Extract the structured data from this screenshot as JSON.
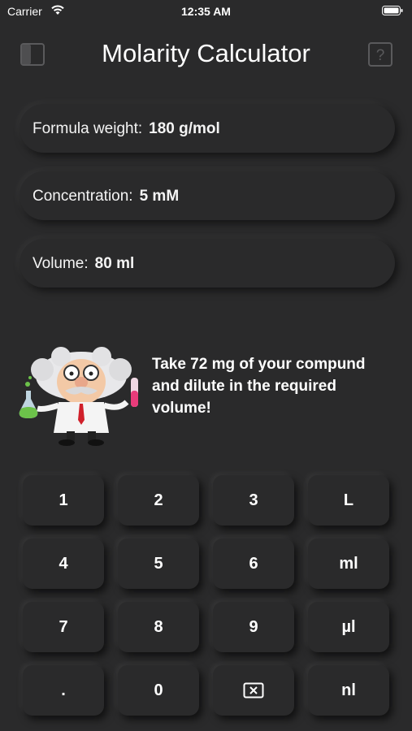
{
  "status": {
    "carrier": "Carrier",
    "time": "12:35 AM"
  },
  "nav": {
    "title": "Molarity Calculator"
  },
  "fields": {
    "formula_weight": {
      "label": "Formula weight:",
      "value": "180 g/mol"
    },
    "concentration": {
      "label": "Concentration:",
      "value": "5 mM"
    },
    "volume": {
      "label": "Volume:",
      "value": "80 ml"
    }
  },
  "result": {
    "message": "Take 72 mg of your compund and dilute in the required volume!"
  },
  "keypad": {
    "k1": "1",
    "k2": "2",
    "k3": "3",
    "unit_l": "L",
    "k4": "4",
    "k5": "5",
    "k6": "6",
    "unit_ml": "ml",
    "k7": "7",
    "k8": "8",
    "k9": "9",
    "unit_ul": "µl",
    "dot": ".",
    "k0": "0",
    "delete_icon": "delete-icon",
    "unit_nl": "nl"
  },
  "colors": {
    "background": "#2a2a2b",
    "flask_green": "#6cc24a",
    "tube_pink": "#e83b7a",
    "tie_red": "#d0202a"
  }
}
